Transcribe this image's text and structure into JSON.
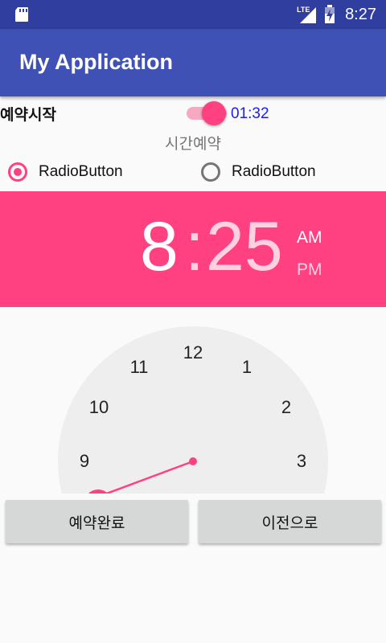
{
  "status_bar": {
    "time": "8:27",
    "network": "LTE"
  },
  "app_bar": {
    "title": "My Application"
  },
  "reservation": {
    "start_label": "예약시작",
    "switch_on": true,
    "countdown": "01:32",
    "section_label": "시간예약"
  },
  "radios": [
    {
      "label": "RadioButton",
      "checked": true
    },
    {
      "label": "RadioButton",
      "checked": false
    }
  ],
  "time_picker": {
    "hour": "8",
    "separator": ":",
    "minute": "25",
    "am": "AM",
    "pm": "PM",
    "dial_numbers": [
      "12",
      "1",
      "2",
      "3",
      "9",
      "10",
      "11"
    ]
  },
  "buttons": {
    "done": "예약완료",
    "back": "이전으로"
  },
  "colors": {
    "primary": "#3f51b5",
    "primary_dark": "#303f9f",
    "accent": "#ff4081"
  }
}
